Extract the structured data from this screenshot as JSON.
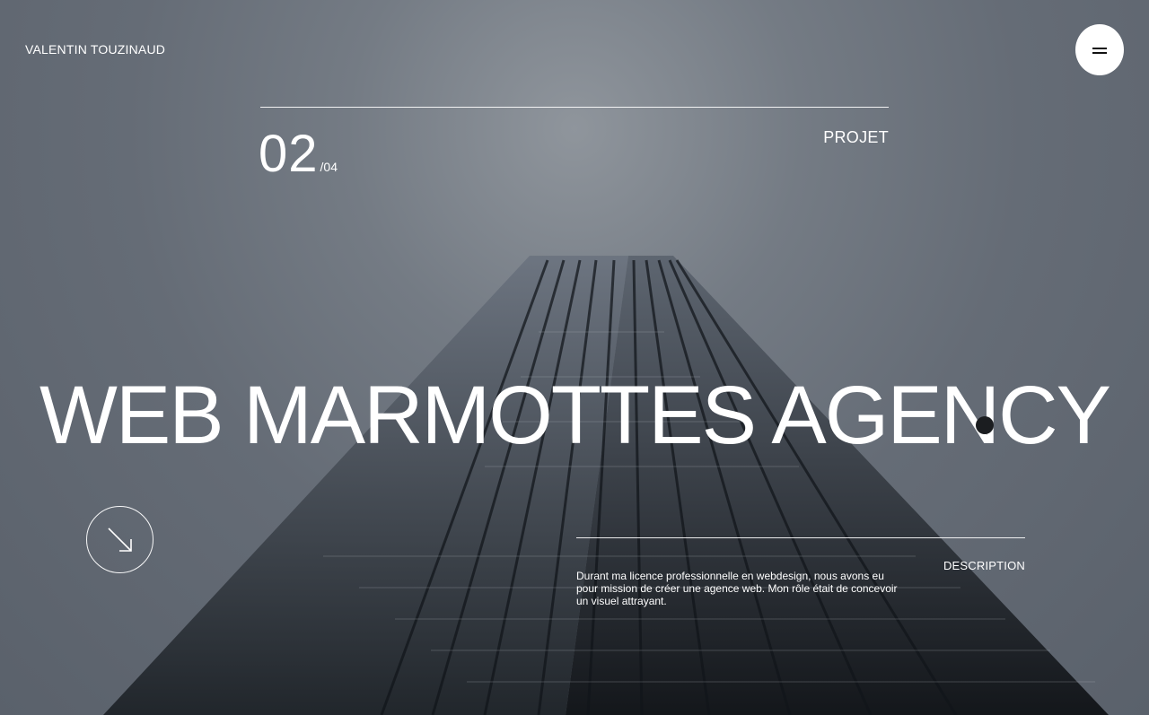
{
  "header": {
    "site_name": "VALENTIN TOUZINAUD"
  },
  "menu": {
    "icon": "hamburger-menu-icon"
  },
  "project": {
    "index": "02",
    "total": "/04",
    "section_label": "PROJET",
    "title": "WEB MARMOTTES AGENCY"
  },
  "scroll": {
    "icon": "arrow-down-right-icon"
  },
  "description": {
    "label": "DESCRIPTION",
    "text": "Durant ma licence professionnelle en webdesign, nous avons eu pour mission de créer une agence web. Mon rôle était de concevoir un visuel attrayant."
  },
  "colors": {
    "background": "#5f6670",
    "text": "#ffffff",
    "menu_button": "#ffffff",
    "dot": "#1b1d20"
  }
}
